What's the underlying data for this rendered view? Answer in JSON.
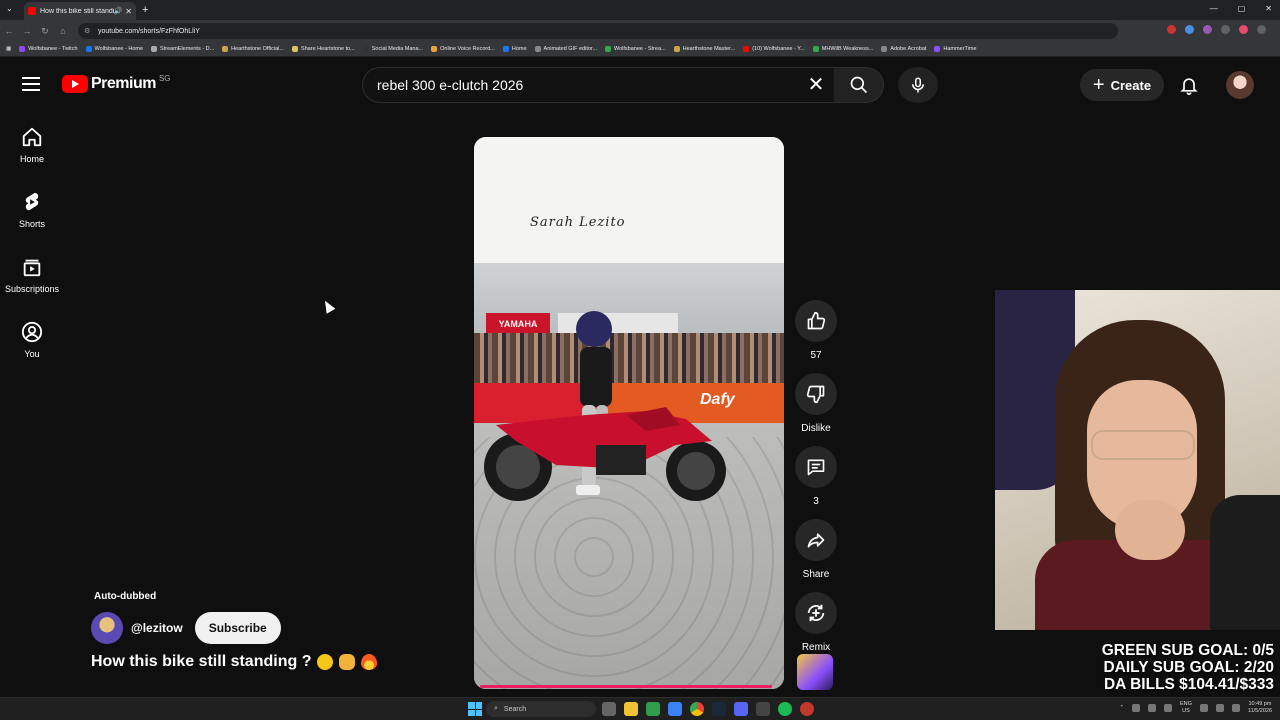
{
  "browser": {
    "tab_title": "How this bike still standing",
    "url": "youtube.com/shorts/FzFhfOhLliY",
    "bookmarks": [
      "Wolfsbanee - Twitch",
      "Wolfsbanee - Home",
      "StreamElements - D...",
      "Hearthstone Official...",
      "Share Heartstone to...",
      "Social Media Mana...",
      "Online Voice Record...",
      "Home",
      "Animated GIF editor...",
      "Wolfsbanee - Strea...",
      "Hearthstone Master...",
      "(10) Wolfsbanee - Y...",
      "MHWilB Weakness...",
      "Adobe Acrobat",
      "HammerTime"
    ]
  },
  "header": {
    "logo_text": "Premium",
    "region": "SG",
    "search_value": "rebel 300 e-clutch 2026",
    "create_label": "Create"
  },
  "sidebar": {
    "items": [
      {
        "label": "Home"
      },
      {
        "label": "Shorts"
      },
      {
        "label": "Subscriptions"
      },
      {
        "label": "You"
      }
    ]
  },
  "video": {
    "watermark": "Sarah Lezito",
    "banner_text": "YAMAHA",
    "fence_text": "Dafy"
  },
  "actions": {
    "like_count": "57",
    "dislike_label": "Dislike",
    "comment_count": "3",
    "share_label": "Share",
    "remix_label": "Remix"
  },
  "meta": {
    "auto_dubbed": "Auto-dubbed",
    "channel_handle": "@lezitow",
    "subscribe_label": "Subscribe",
    "title": "How this bike still standing ?"
  },
  "overlay": {
    "goal_green": "GREEN SUB GOAL: 0/5",
    "goal_daily": "DAILY SUB GOAL: 2/20",
    "bills": "DA BILLS $104.41/$333"
  },
  "taskbar": {
    "search_label": "Search",
    "lang": "ENG",
    "region": "US",
    "time": "10:49 pm",
    "date": "11/5/2026"
  },
  "colors": {
    "youtube_red": "#ff0000",
    "progress": "#e91e63",
    "background": "#0f0f0f"
  }
}
